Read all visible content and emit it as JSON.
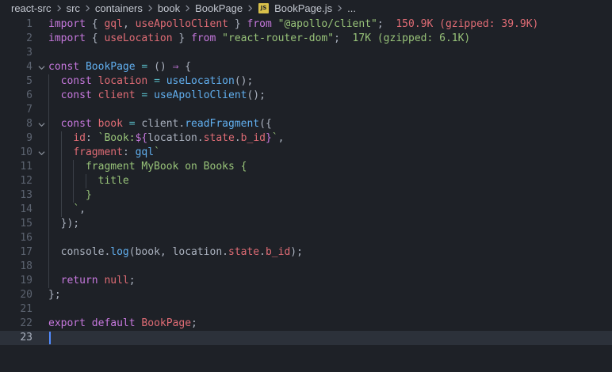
{
  "breadcrumb": {
    "items": [
      "react-src",
      "src",
      "containers",
      "book",
      "BookPage"
    ],
    "file": "BookPage.js",
    "ellipsis": "...",
    "file_icon_label": "JS"
  },
  "editor": {
    "current_line": 23,
    "lines": [
      {
        "n": 1,
        "fold": false,
        "indent": 0,
        "tokens": [
          [
            "kw",
            "import"
          ],
          [
            "pl",
            " { "
          ],
          [
            "var",
            "gql"
          ],
          [
            "pl",
            ", "
          ],
          [
            "var",
            "useApolloClient"
          ],
          [
            "pl",
            " } "
          ],
          [
            "kw",
            "from"
          ],
          [
            "pl",
            " "
          ],
          [
            "str",
            "\"@apollo/client\""
          ],
          [
            "pl",
            ";  "
          ],
          [
            "sz-big",
            "150.9K (gzipped: 39.9K)"
          ]
        ]
      },
      {
        "n": 2,
        "fold": false,
        "indent": 0,
        "tokens": [
          [
            "kw",
            "import"
          ],
          [
            "pl",
            " { "
          ],
          [
            "var",
            "useLocation"
          ],
          [
            "pl",
            " } "
          ],
          [
            "kw",
            "from"
          ],
          [
            "pl",
            " "
          ],
          [
            "str",
            "\"react-router-dom\""
          ],
          [
            "pl",
            ";  "
          ],
          [
            "sz-ok",
            "17K (gzipped: 6.1K)"
          ]
        ]
      },
      {
        "n": 3,
        "fold": false,
        "indent": 0,
        "tokens": []
      },
      {
        "n": 4,
        "fold": true,
        "indent": 0,
        "tokens": [
          [
            "kw",
            "const"
          ],
          [
            "pl",
            " "
          ],
          [
            "fn",
            "BookPage"
          ],
          [
            "pl",
            " "
          ],
          [
            "op",
            "="
          ],
          [
            "pl",
            " () "
          ],
          [
            "kw",
            "⇒"
          ],
          [
            "pl",
            " {"
          ]
        ]
      },
      {
        "n": 5,
        "fold": false,
        "indent": 1,
        "tokens": [
          [
            "pl",
            "  "
          ],
          [
            "kw",
            "const"
          ],
          [
            "pl",
            " "
          ],
          [
            "var",
            "location"
          ],
          [
            "pl",
            " "
          ],
          [
            "op",
            "="
          ],
          [
            "pl",
            " "
          ],
          [
            "fn",
            "useLocation"
          ],
          [
            "pl",
            "();"
          ]
        ]
      },
      {
        "n": 6,
        "fold": false,
        "indent": 1,
        "tokens": [
          [
            "pl",
            "  "
          ],
          [
            "kw",
            "const"
          ],
          [
            "pl",
            " "
          ],
          [
            "var",
            "client"
          ],
          [
            "pl",
            " "
          ],
          [
            "op",
            "="
          ],
          [
            "pl",
            " "
          ],
          [
            "fn",
            "useApolloClient"
          ],
          [
            "pl",
            "();"
          ]
        ]
      },
      {
        "n": 7,
        "fold": false,
        "indent": 1,
        "tokens": []
      },
      {
        "n": 8,
        "fold": true,
        "indent": 1,
        "tokens": [
          [
            "pl",
            "  "
          ],
          [
            "kw",
            "const"
          ],
          [
            "pl",
            " "
          ],
          [
            "var",
            "book"
          ],
          [
            "pl",
            " "
          ],
          [
            "op",
            "="
          ],
          [
            "pl",
            " client."
          ],
          [
            "fn",
            "readFragment"
          ],
          [
            "pl",
            "({"
          ]
        ]
      },
      {
        "n": 9,
        "fold": false,
        "indent": 2,
        "tokens": [
          [
            "pl",
            "    "
          ],
          [
            "var",
            "id"
          ],
          [
            "pl",
            ": "
          ],
          [
            "str",
            "`Book:"
          ],
          [
            "tpl",
            "${"
          ],
          [
            "pl",
            "location."
          ],
          [
            "var",
            "state"
          ],
          [
            "pl",
            "."
          ],
          [
            "var",
            "b_id"
          ],
          [
            "tpl",
            "}"
          ],
          [
            "str",
            "`"
          ],
          [
            "pl",
            ","
          ]
        ]
      },
      {
        "n": 10,
        "fold": true,
        "indent": 2,
        "tokens": [
          [
            "pl",
            "    "
          ],
          [
            "var",
            "fragment"
          ],
          [
            "pl",
            ": "
          ],
          [
            "fn",
            "gql"
          ],
          [
            "str",
            "`"
          ]
        ]
      },
      {
        "n": 11,
        "fold": false,
        "indent": 3,
        "tokens": [
          [
            "pl",
            "      "
          ],
          [
            "str",
            "fragment MyBook on Books {"
          ]
        ]
      },
      {
        "n": 12,
        "fold": false,
        "indent": 4,
        "tokens": [
          [
            "pl",
            "        "
          ],
          [
            "str",
            "title"
          ]
        ]
      },
      {
        "n": 13,
        "fold": false,
        "indent": 3,
        "tokens": [
          [
            "pl",
            "      "
          ],
          [
            "str",
            "}"
          ]
        ]
      },
      {
        "n": 14,
        "fold": false,
        "indent": 2,
        "tokens": [
          [
            "pl",
            "    "
          ],
          [
            "str",
            "`"
          ],
          [
            "pl",
            ","
          ]
        ]
      },
      {
        "n": 15,
        "fold": false,
        "indent": 1,
        "tokens": [
          [
            "pl",
            "  });"
          ]
        ]
      },
      {
        "n": 16,
        "fold": false,
        "indent": 1,
        "tokens": []
      },
      {
        "n": 17,
        "fold": false,
        "indent": 1,
        "tokens": [
          [
            "pl",
            "  console."
          ],
          [
            "fn",
            "log"
          ],
          [
            "pl",
            "(book, location."
          ],
          [
            "var",
            "state"
          ],
          [
            "pl",
            "."
          ],
          [
            "var",
            "b_id"
          ],
          [
            "pl",
            ");"
          ]
        ]
      },
      {
        "n": 18,
        "fold": false,
        "indent": 1,
        "tokens": []
      },
      {
        "n": 19,
        "fold": false,
        "indent": 1,
        "tokens": [
          [
            "pl",
            "  "
          ],
          [
            "kw",
            "return"
          ],
          [
            "pl",
            " "
          ],
          [
            "var",
            "null"
          ],
          [
            "pl",
            ";"
          ]
        ]
      },
      {
        "n": 20,
        "fold": false,
        "indent": 0,
        "tokens": [
          [
            "pl",
            "};"
          ]
        ]
      },
      {
        "n": 21,
        "fold": false,
        "indent": 0,
        "tokens": []
      },
      {
        "n": 22,
        "fold": false,
        "indent": 0,
        "tokens": [
          [
            "kw",
            "export"
          ],
          [
            "pl",
            " "
          ],
          [
            "kw",
            "default"
          ],
          [
            "pl",
            " "
          ],
          [
            "var",
            "BookPage"
          ],
          [
            "pl",
            ";"
          ]
        ]
      },
      {
        "n": 23,
        "fold": false,
        "indent": 0,
        "tokens": []
      }
    ]
  }
}
